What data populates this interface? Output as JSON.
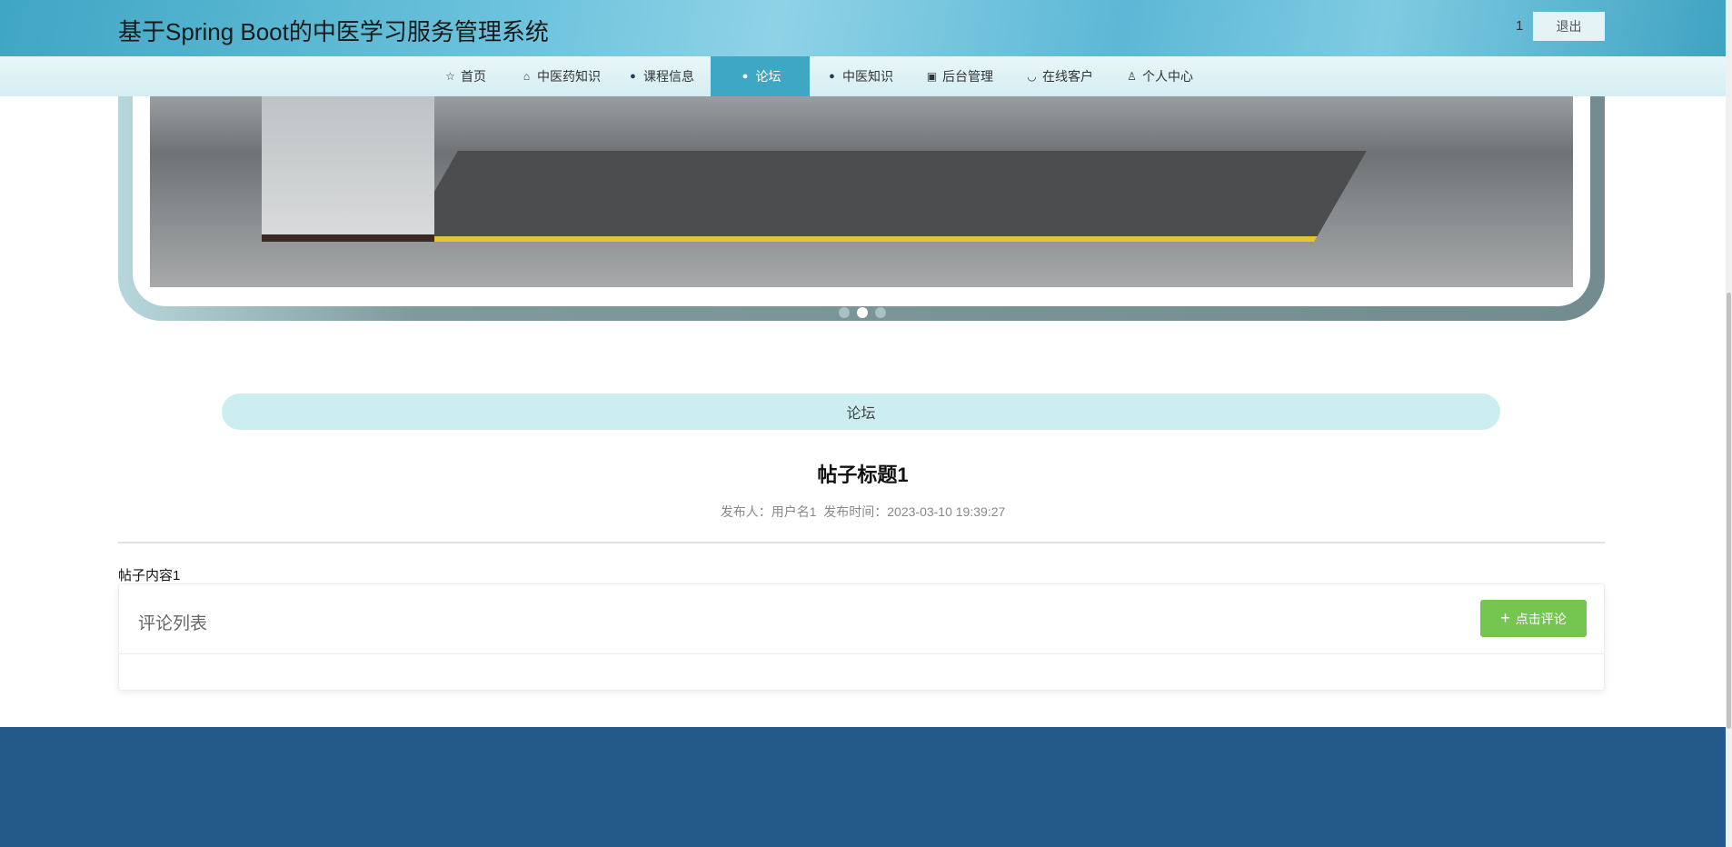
{
  "header": {
    "title": "基于Spring Boot的中医学习服务管理系统",
    "user": "1",
    "logout_label": "退出"
  },
  "nav": {
    "items": [
      {
        "label": "首页",
        "icon": "star-icon",
        "glyph": "☆"
      },
      {
        "label": "中医药知识",
        "icon": "bag-icon",
        "glyph": "⌂"
      },
      {
        "label": "课程信息",
        "icon": "info-icon",
        "glyph": "●"
      },
      {
        "label": "论坛",
        "icon": "question-icon",
        "glyph": "●",
        "active": true
      },
      {
        "label": "中医知识",
        "icon": "info-icon",
        "glyph": "●"
      },
      {
        "label": "后台管理",
        "icon": "box-icon",
        "glyph": "▣"
      },
      {
        "label": "在线客户",
        "icon": "headset-icon",
        "glyph": "◡"
      },
      {
        "label": "个人中心",
        "icon": "user-icon",
        "glyph": "♙"
      }
    ]
  },
  "carousel": {
    "slide_count": 3,
    "active_index": 1
  },
  "section": {
    "title": "论坛"
  },
  "post": {
    "title": "帖子标题1",
    "meta": "发布人：用户名1  发布时间：2023-03-10 19:39:27",
    "content": "帖子内容1"
  },
  "comments": {
    "title": "评论列表",
    "add_label": "点击评论",
    "add_icon": "+"
  },
  "colors": {
    "accent": "#3ea7c4",
    "button": "#74c651",
    "footer": "#235a8a",
    "section_bar": "#cdeef1"
  }
}
